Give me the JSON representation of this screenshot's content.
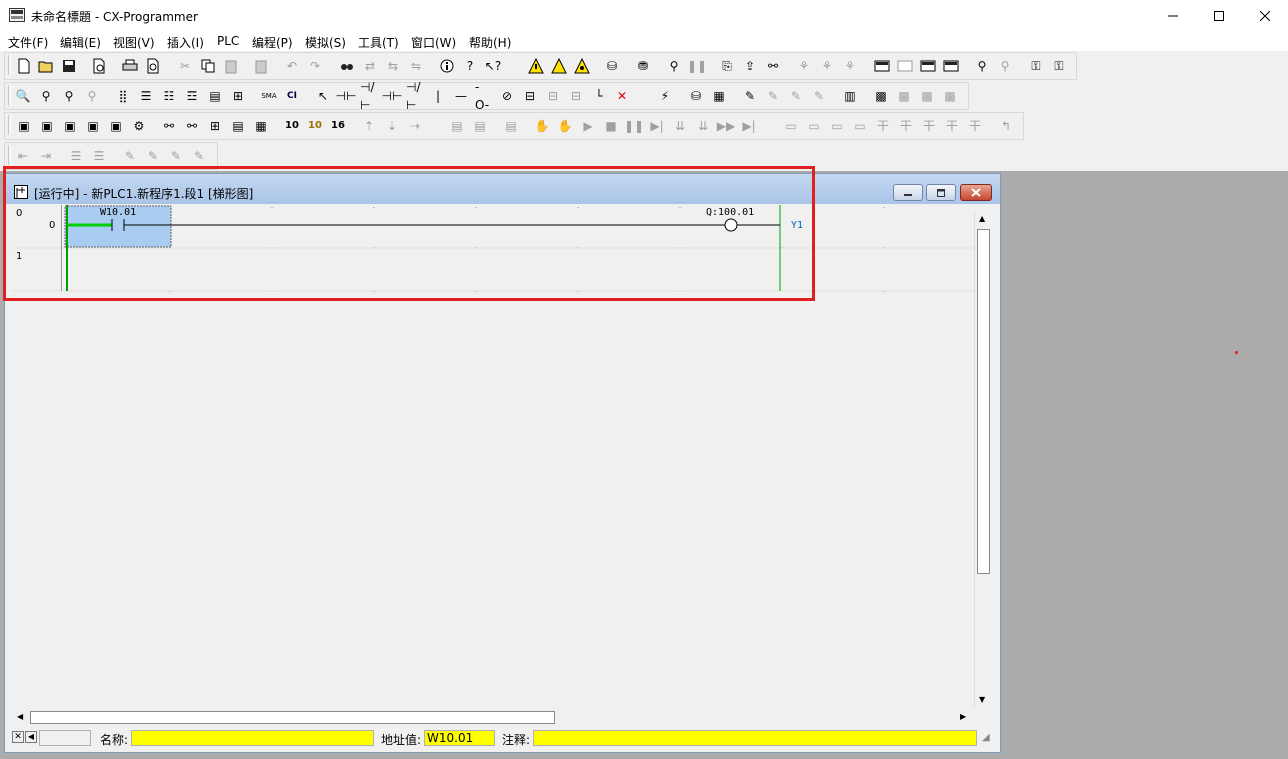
{
  "window": {
    "title": "未命名標題 - CX-Programmer"
  },
  "menu": [
    "文件(F)",
    "编辑(E)",
    "视图(V)",
    "插入(I)",
    "PLC",
    "编程(P)",
    "模拟(S)",
    "工具(T)",
    "窗口(W)",
    "帮助(H)"
  ],
  "toolbar": {
    "numeric_buttons": [
      "10",
      "10",
      "16"
    ],
    "sma_label": "SMA",
    "ci_label": "CI"
  },
  "child_window": {
    "title": "[运行中] - 新PLC1.新程序1.段1 [梯形图]"
  },
  "ladder": {
    "rungs": [
      {
        "rung": "0",
        "step": "0",
        "contact_address": "W10.01",
        "coil_address": "Q:100.01",
        "coil_comment": "Y1"
      },
      {
        "rung": "1",
        "step": ""
      }
    ]
  },
  "status": {
    "name_label": "名称:",
    "name_value": "",
    "address_label": "地址值:",
    "address_value": "W10.01",
    "comment_label": "注释:",
    "comment_value": ""
  },
  "colors": {
    "highlight_box": "#e02020",
    "selection": "#a8cdf0",
    "power_flow": "#00c000",
    "status_field": "#ffff00"
  }
}
